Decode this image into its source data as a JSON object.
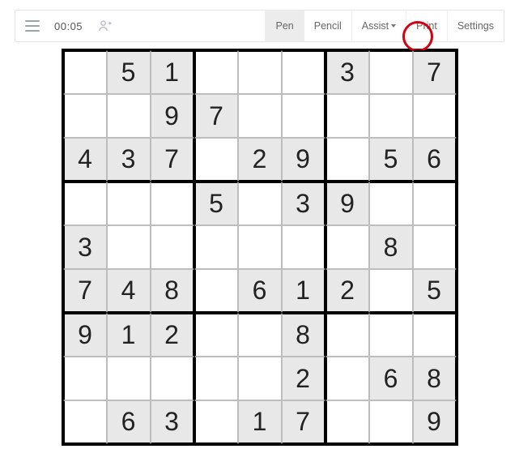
{
  "toolbar": {
    "timer": "00:05",
    "pen": "Pen",
    "pencil": "Pencil",
    "assist": "Assist",
    "print": "Print",
    "settings": "Settings"
  },
  "highlight": {
    "target": "print-button"
  },
  "sudoku": {
    "grid": [
      [
        "",
        "5",
        "1",
        "",
        "",
        "",
        "3",
        "",
        "7"
      ],
      [
        "",
        "",
        "9",
        "7",
        "",
        "",
        "",
        "",
        ""
      ],
      [
        "4",
        "3",
        "7",
        "",
        "2",
        "9",
        "",
        "5",
        "6"
      ],
      [
        "",
        "",
        "",
        "5",
        "",
        "3",
        "9",
        "",
        ""
      ],
      [
        "3",
        "",
        "",
        "",
        "",
        "",
        "",
        "8",
        ""
      ],
      [
        "7",
        "4",
        "8",
        "",
        "6",
        "1",
        "2",
        "",
        "5"
      ],
      [
        "9",
        "1",
        "2",
        "",
        "",
        "8",
        "",
        "",
        ""
      ],
      [
        "",
        "",
        "",
        "",
        "",
        "2",
        "",
        "6",
        "8"
      ],
      [
        "",
        "6",
        "3",
        "",
        "1",
        "7",
        "",
        "",
        "9"
      ]
    ]
  }
}
